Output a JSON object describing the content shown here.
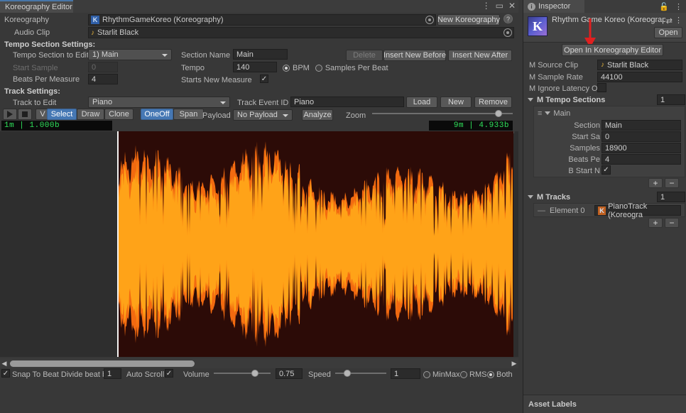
{
  "editor_window": {
    "tab_label": "Koreography Editor",
    "window_buttons": {
      "menu": "⋮",
      "maximize": "▭",
      "close": "✕"
    },
    "koreography": {
      "label": "Koreography",
      "value": "RhythmGameKoreo (Koreography)",
      "icon": "koreography-asset-icon",
      "new_button": "New Koreography",
      "help_button": "?"
    },
    "audio_clip": {
      "label": "Audio Clip",
      "value": "Starlit Black",
      "icon": "music-note-icon"
    },
    "tempo_section_settings": {
      "header": "Tempo Section Settings:",
      "section_to_edit_label": "Tempo Section to Edit",
      "section_to_edit_value": "1) Main",
      "start_sample_label": "Start Sample",
      "start_sample_value": "0",
      "beats_per_measure_label": "Beats Per Measure",
      "beats_per_measure_value": "4",
      "section_name_label": "Section Name",
      "section_name_value": "Main",
      "tempo_label": "Tempo",
      "tempo_value": "140",
      "bpm_label": "BPM",
      "samples_per_beat_label": "Samples Per Beat",
      "starts_new_measure_label": "Starts New Measure",
      "starts_new_measure_checked": "✓",
      "delete_button": "Delete",
      "insert_before_button": "Insert New Before",
      "insert_after_button": "Insert New After"
    },
    "track_settings": {
      "header": "Track Settings:",
      "track_to_edit_label": "Track to Edit",
      "track_to_edit_value": "Piano",
      "track_event_id_label": "Track Event ID",
      "track_event_id_value": "Piano",
      "load_button": "Load",
      "new_button": "New",
      "remove_button": "Remove",
      "mode_v": "V",
      "select_button": "Select",
      "draw_button": "Draw",
      "clone_button": "Clone",
      "oneoff_button": "OneOff",
      "span_button": "Span",
      "payload_label": "Payload",
      "payload_value": "No Payload",
      "analyze_button": "Analyze",
      "zoom_label": "Zoom",
      "zoom_percent": 92
    },
    "timeline": {
      "left_time": "1m | 1.000b",
      "right_time": "9m | 4.933b"
    },
    "bottom_bar": {
      "snap_checked": "✓",
      "snap_label": "Snap To Beat Divide beat by",
      "snap_divide_value": "1",
      "auto_scroll_label": "Auto Scroll",
      "auto_scroll_checked": "✓",
      "volume_label": "Volume",
      "volume_value": "0.75",
      "volume_percent": 75,
      "speed_label": "Speed",
      "speed_value": "1",
      "speed_percent": 20,
      "minmax_label": "MinMax",
      "rms_label": "RMS",
      "both_label": "Both",
      "display_mode": "Both"
    },
    "scrollbar": {
      "left_arrow": "◀",
      "right_arrow": "▶",
      "thumb_percent": 60
    }
  },
  "inspector": {
    "tab_label": "Inspector",
    "info_icon": "info-icon",
    "lock_icon": "lock-icon",
    "menu_icon": "kebab-menu-icon",
    "asset_title": "Rhythm Game Koreo (Koreograp",
    "asset_icon": "koreography-asset-icon",
    "preset_icon": "preset-icon",
    "open_button": "Open",
    "open_in_editor_button": "Open In Koreography Editor",
    "annotation_arrow_color": "#e02020",
    "fields": [
      {
        "label": "M Source Clip",
        "value": "Starlit Black",
        "type": "object",
        "icon": "music-note-icon"
      },
      {
        "label": "M Sample Rate",
        "value": "44100",
        "type": "text"
      },
      {
        "label": "M Ignore Latency Off",
        "value": "",
        "type": "checkbox",
        "checked": false
      }
    ],
    "tempo_sections": {
      "label": "M Tempo Sections",
      "count": "1",
      "element_label": "Main",
      "rows": [
        {
          "label": "Section",
          "value": "Main",
          "type": "text"
        },
        {
          "label": "Start Sa",
          "value": "0",
          "type": "text"
        },
        {
          "label": "Samples",
          "value": "18900",
          "type": "text"
        },
        {
          "label": "Beats Pe",
          "value": "4",
          "type": "text"
        },
        {
          "label": "B Start N",
          "value": "✓",
          "type": "checkbox"
        }
      ],
      "add_button": "+",
      "remove_button": "−"
    },
    "tracks": {
      "label": "M Tracks",
      "count": "1",
      "element_label": "Element 0",
      "element_value": "PianoTrack (Koreogra",
      "add_button": "+",
      "remove_button": "−"
    },
    "asset_labels": "Asset Labels"
  },
  "colors": {
    "accent_blue": "#4678b4",
    "waveform_bg": "#2c0b07",
    "waveform_minmax": "#f26a10",
    "waveform_rms": "#ffa318",
    "time_text": "#2fe05a",
    "annotation_red": "#e02020"
  }
}
